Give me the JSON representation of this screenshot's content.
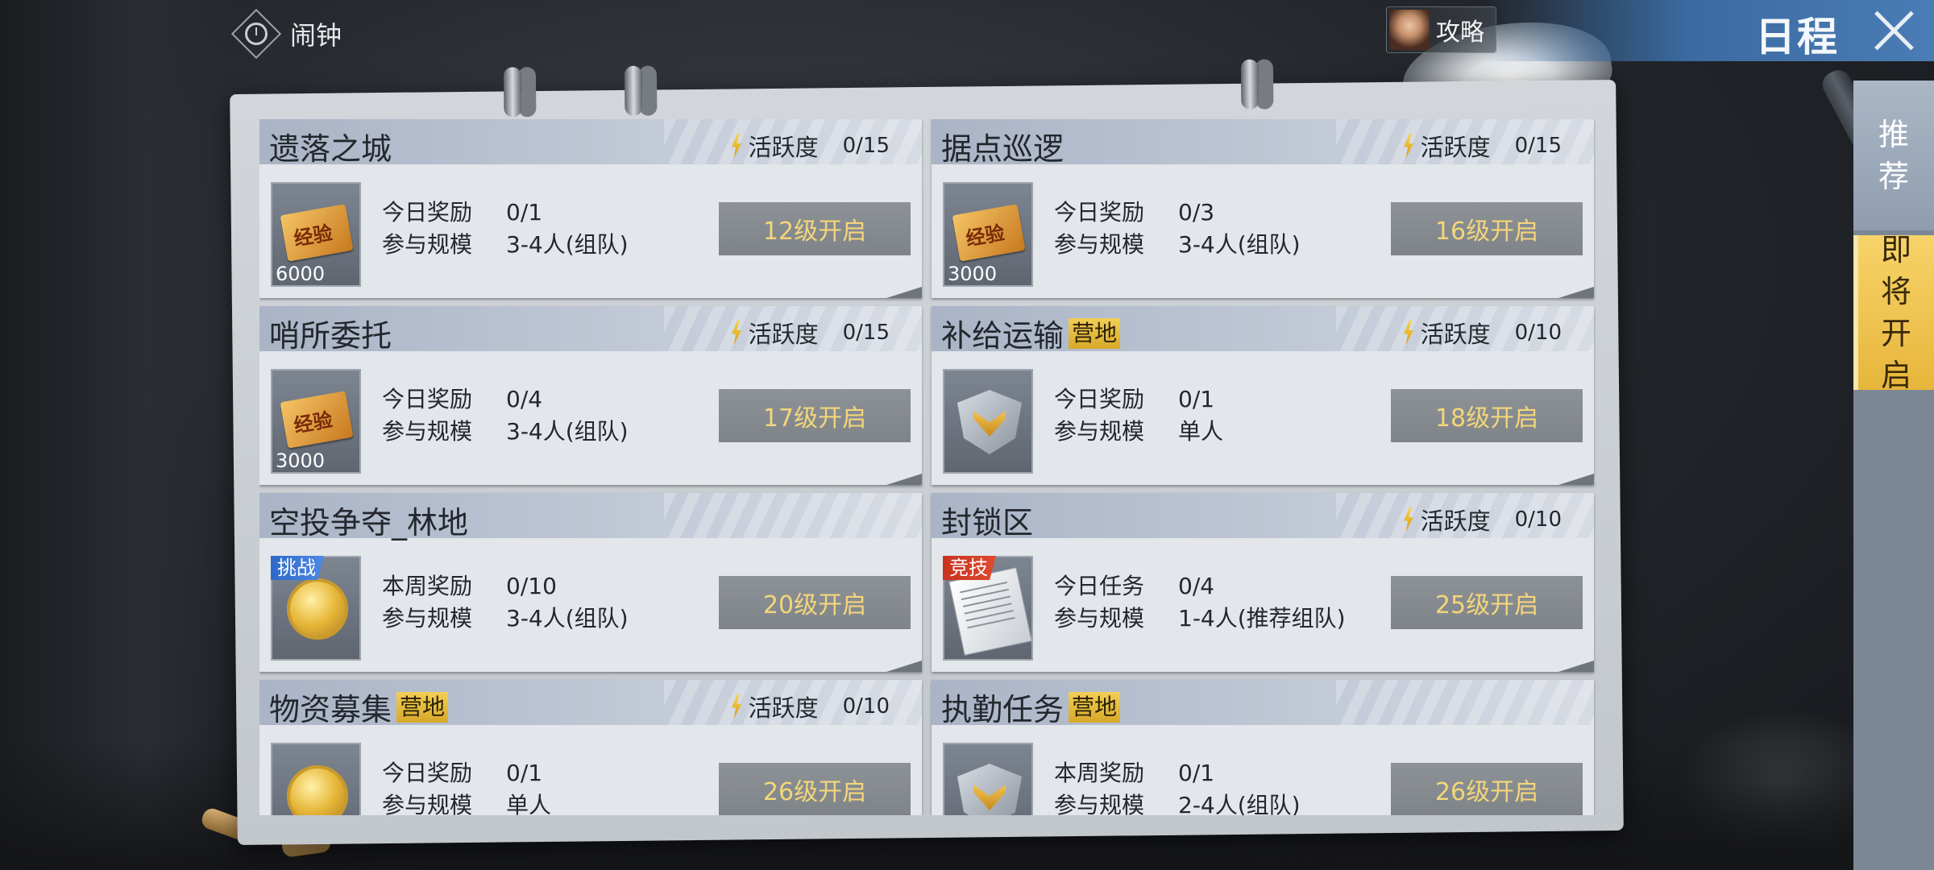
{
  "top_bar": {
    "alarm_label": "闹钟",
    "guide_label": "攻略",
    "title": "日程"
  },
  "side_tabs": {
    "recommend": [
      "推",
      "荐"
    ],
    "upcoming": [
      "即",
      "将",
      "开",
      "启"
    ]
  },
  "colors": {
    "title_banner": "#4a7cb5",
    "upcoming_tab": "#f0c64e",
    "unlock_text": "#f3d67a",
    "card_bg": "#e3e6ea"
  },
  "cards": [
    {
      "title": "遗落之城",
      "tag": "",
      "activity_label": "活跃度",
      "activity_value": "0/15",
      "reward_label": "今日奖励",
      "reward_value": "0/1",
      "scale_label": "参与规模",
      "scale_value": "3-4人(组队)",
      "item_count": "6000",
      "item_icon": "exp-ticket-icon",
      "corner_tag": "",
      "button": "12级开启"
    },
    {
      "title": "据点巡逻",
      "tag": "",
      "activity_label": "活跃度",
      "activity_value": "0/15",
      "reward_label": "今日奖励",
      "reward_value": "0/3",
      "scale_label": "参与规模",
      "scale_value": "3-4人(组队)",
      "item_count": "3000",
      "item_icon": "exp-ticket-icon",
      "corner_tag": "",
      "button": "16级开启"
    },
    {
      "title": "哨所委托",
      "tag": "",
      "activity_label": "活跃度",
      "activity_value": "0/15",
      "reward_label": "今日奖励",
      "reward_value": "0/4",
      "scale_label": "参与规模",
      "scale_value": "3-4人(组队)",
      "item_count": "3000",
      "item_icon": "exp-ticket-icon",
      "corner_tag": "",
      "button": "17级开启"
    },
    {
      "title": "补给运输",
      "tag": "营地",
      "activity_label": "活跃度",
      "activity_value": "0/10",
      "reward_label": "今日奖励",
      "reward_value": "0/1",
      "scale_label": "参与规模",
      "scale_value": "单人",
      "item_count": "",
      "item_icon": "badge-icon",
      "corner_tag": "",
      "button": "18级开启"
    },
    {
      "title": "空投争夺_林地",
      "tag": "",
      "activity_label": "",
      "activity_value": "",
      "reward_label": "本周奖励",
      "reward_value": "0/10",
      "scale_label": "参与规模",
      "scale_value": "3-4人(组队)",
      "item_count": "",
      "item_icon": "coin-icon",
      "corner_tag": "挑战",
      "button": "20级开启"
    },
    {
      "title": "封锁区",
      "tag": "",
      "activity_label": "活跃度",
      "activity_value": "0/10",
      "reward_label": "今日任务",
      "reward_value": "0/4",
      "scale_label": "参与规模",
      "scale_value": "1-4人(推荐组队)",
      "item_count": "",
      "item_icon": "paper-icon",
      "corner_tag": "竞技",
      "button": "25级开启"
    },
    {
      "title": "物资募集",
      "tag": "营地",
      "activity_label": "活跃度",
      "activity_value": "0/10",
      "reward_label": "今日奖励",
      "reward_value": "0/1",
      "scale_label": "参与规模",
      "scale_value": "单人",
      "item_count": "",
      "item_icon": "coin-icon",
      "corner_tag": "",
      "button": "26级开启"
    },
    {
      "title": "执勤任务",
      "tag": "营地",
      "activity_label": "",
      "activity_value": "",
      "reward_label": "本周奖励",
      "reward_value": "0/1",
      "scale_label": "参与规模",
      "scale_value": "2-4人(组队)",
      "item_count": "",
      "item_icon": "badge-icon",
      "corner_tag": "",
      "button": "26级开启"
    }
  ]
}
